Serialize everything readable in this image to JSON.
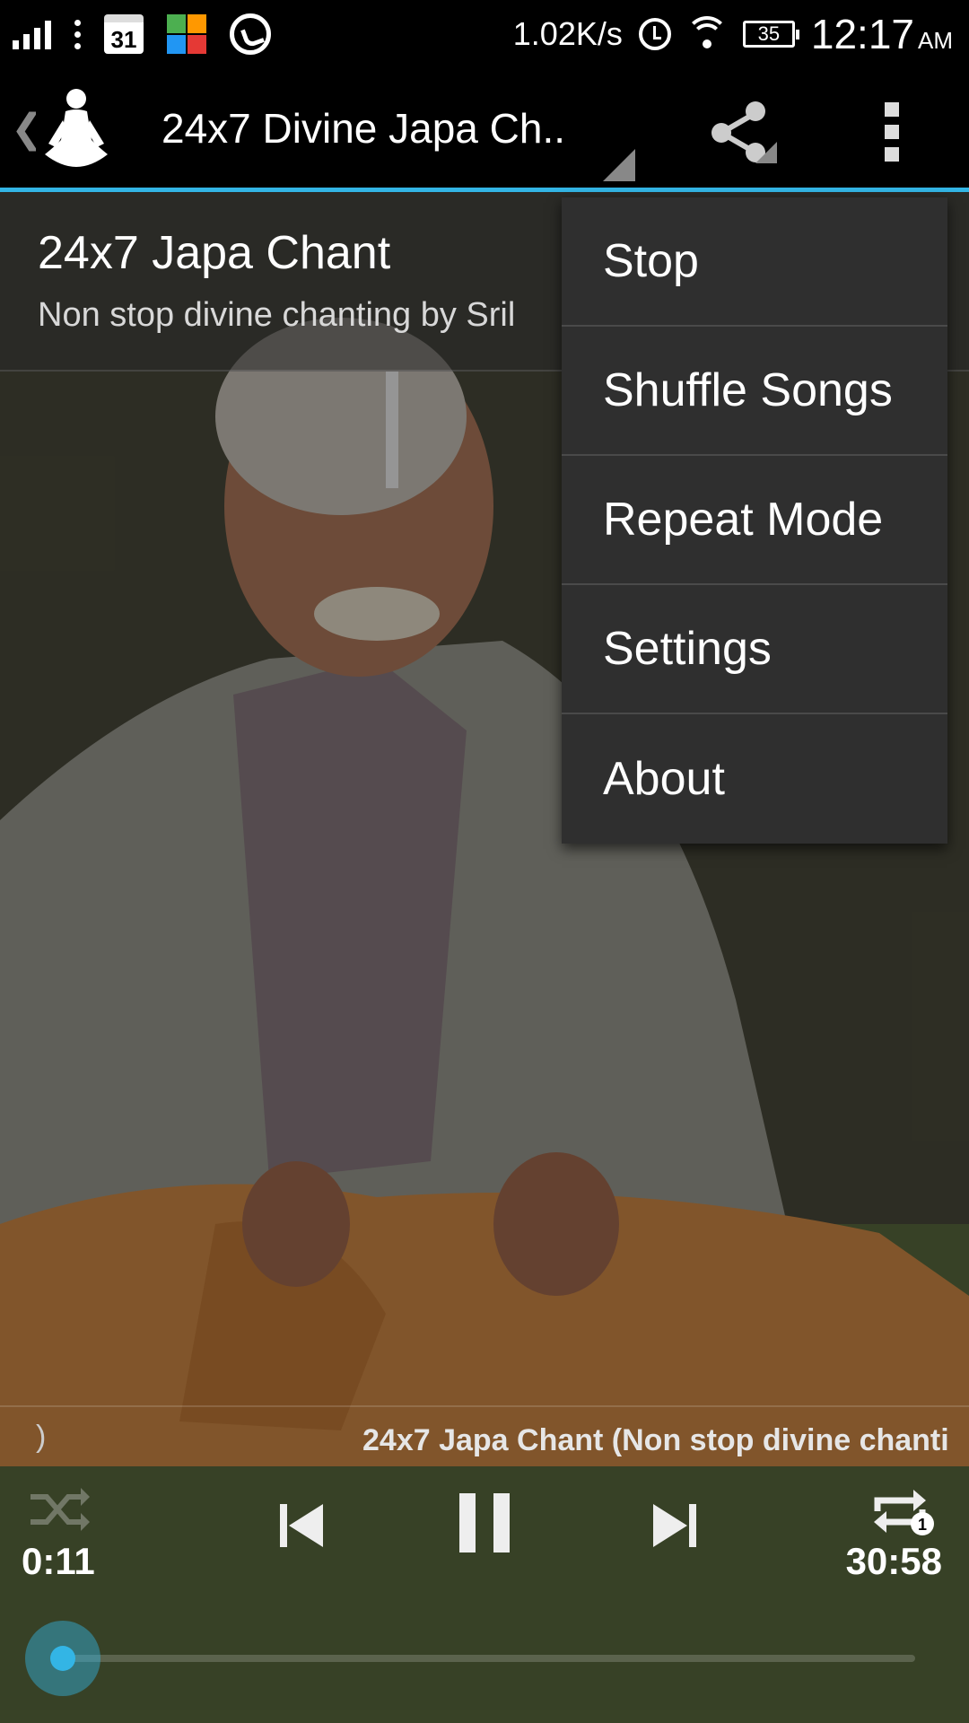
{
  "status_bar": {
    "net_speed": "1.02K/s",
    "calendar_day": "31",
    "battery_level": "35",
    "time": "12:17",
    "ampm": "AM"
  },
  "action_bar": {
    "title": "24x7 Divine Japa Ch..",
    "icons": [
      "up-caret",
      "meditation-logo",
      "share-icon",
      "overflow-menu-icon"
    ]
  },
  "header": {
    "title": "24x7 Japa Chant",
    "subtitle": "Non stop divine chanting by Sril"
  },
  "marquee": {
    "start_fragment": ")",
    "text": "24x7 Japa Chant (Non stop divine chanti"
  },
  "player": {
    "elapsed": "0:11",
    "duration": "30:58",
    "progress": 0.006,
    "controls": [
      "shuffle",
      "previous",
      "pause",
      "next",
      "repeat-one"
    ]
  },
  "menu": {
    "items": [
      {
        "label": "Stop"
      },
      {
        "label": "Shuffle Songs"
      },
      {
        "label": "Repeat Mode"
      },
      {
        "label": "Settings"
      },
      {
        "label": "About"
      }
    ]
  },
  "colors": {
    "accent": "#33b5e5",
    "menu_bg": "#2f2f2f"
  }
}
